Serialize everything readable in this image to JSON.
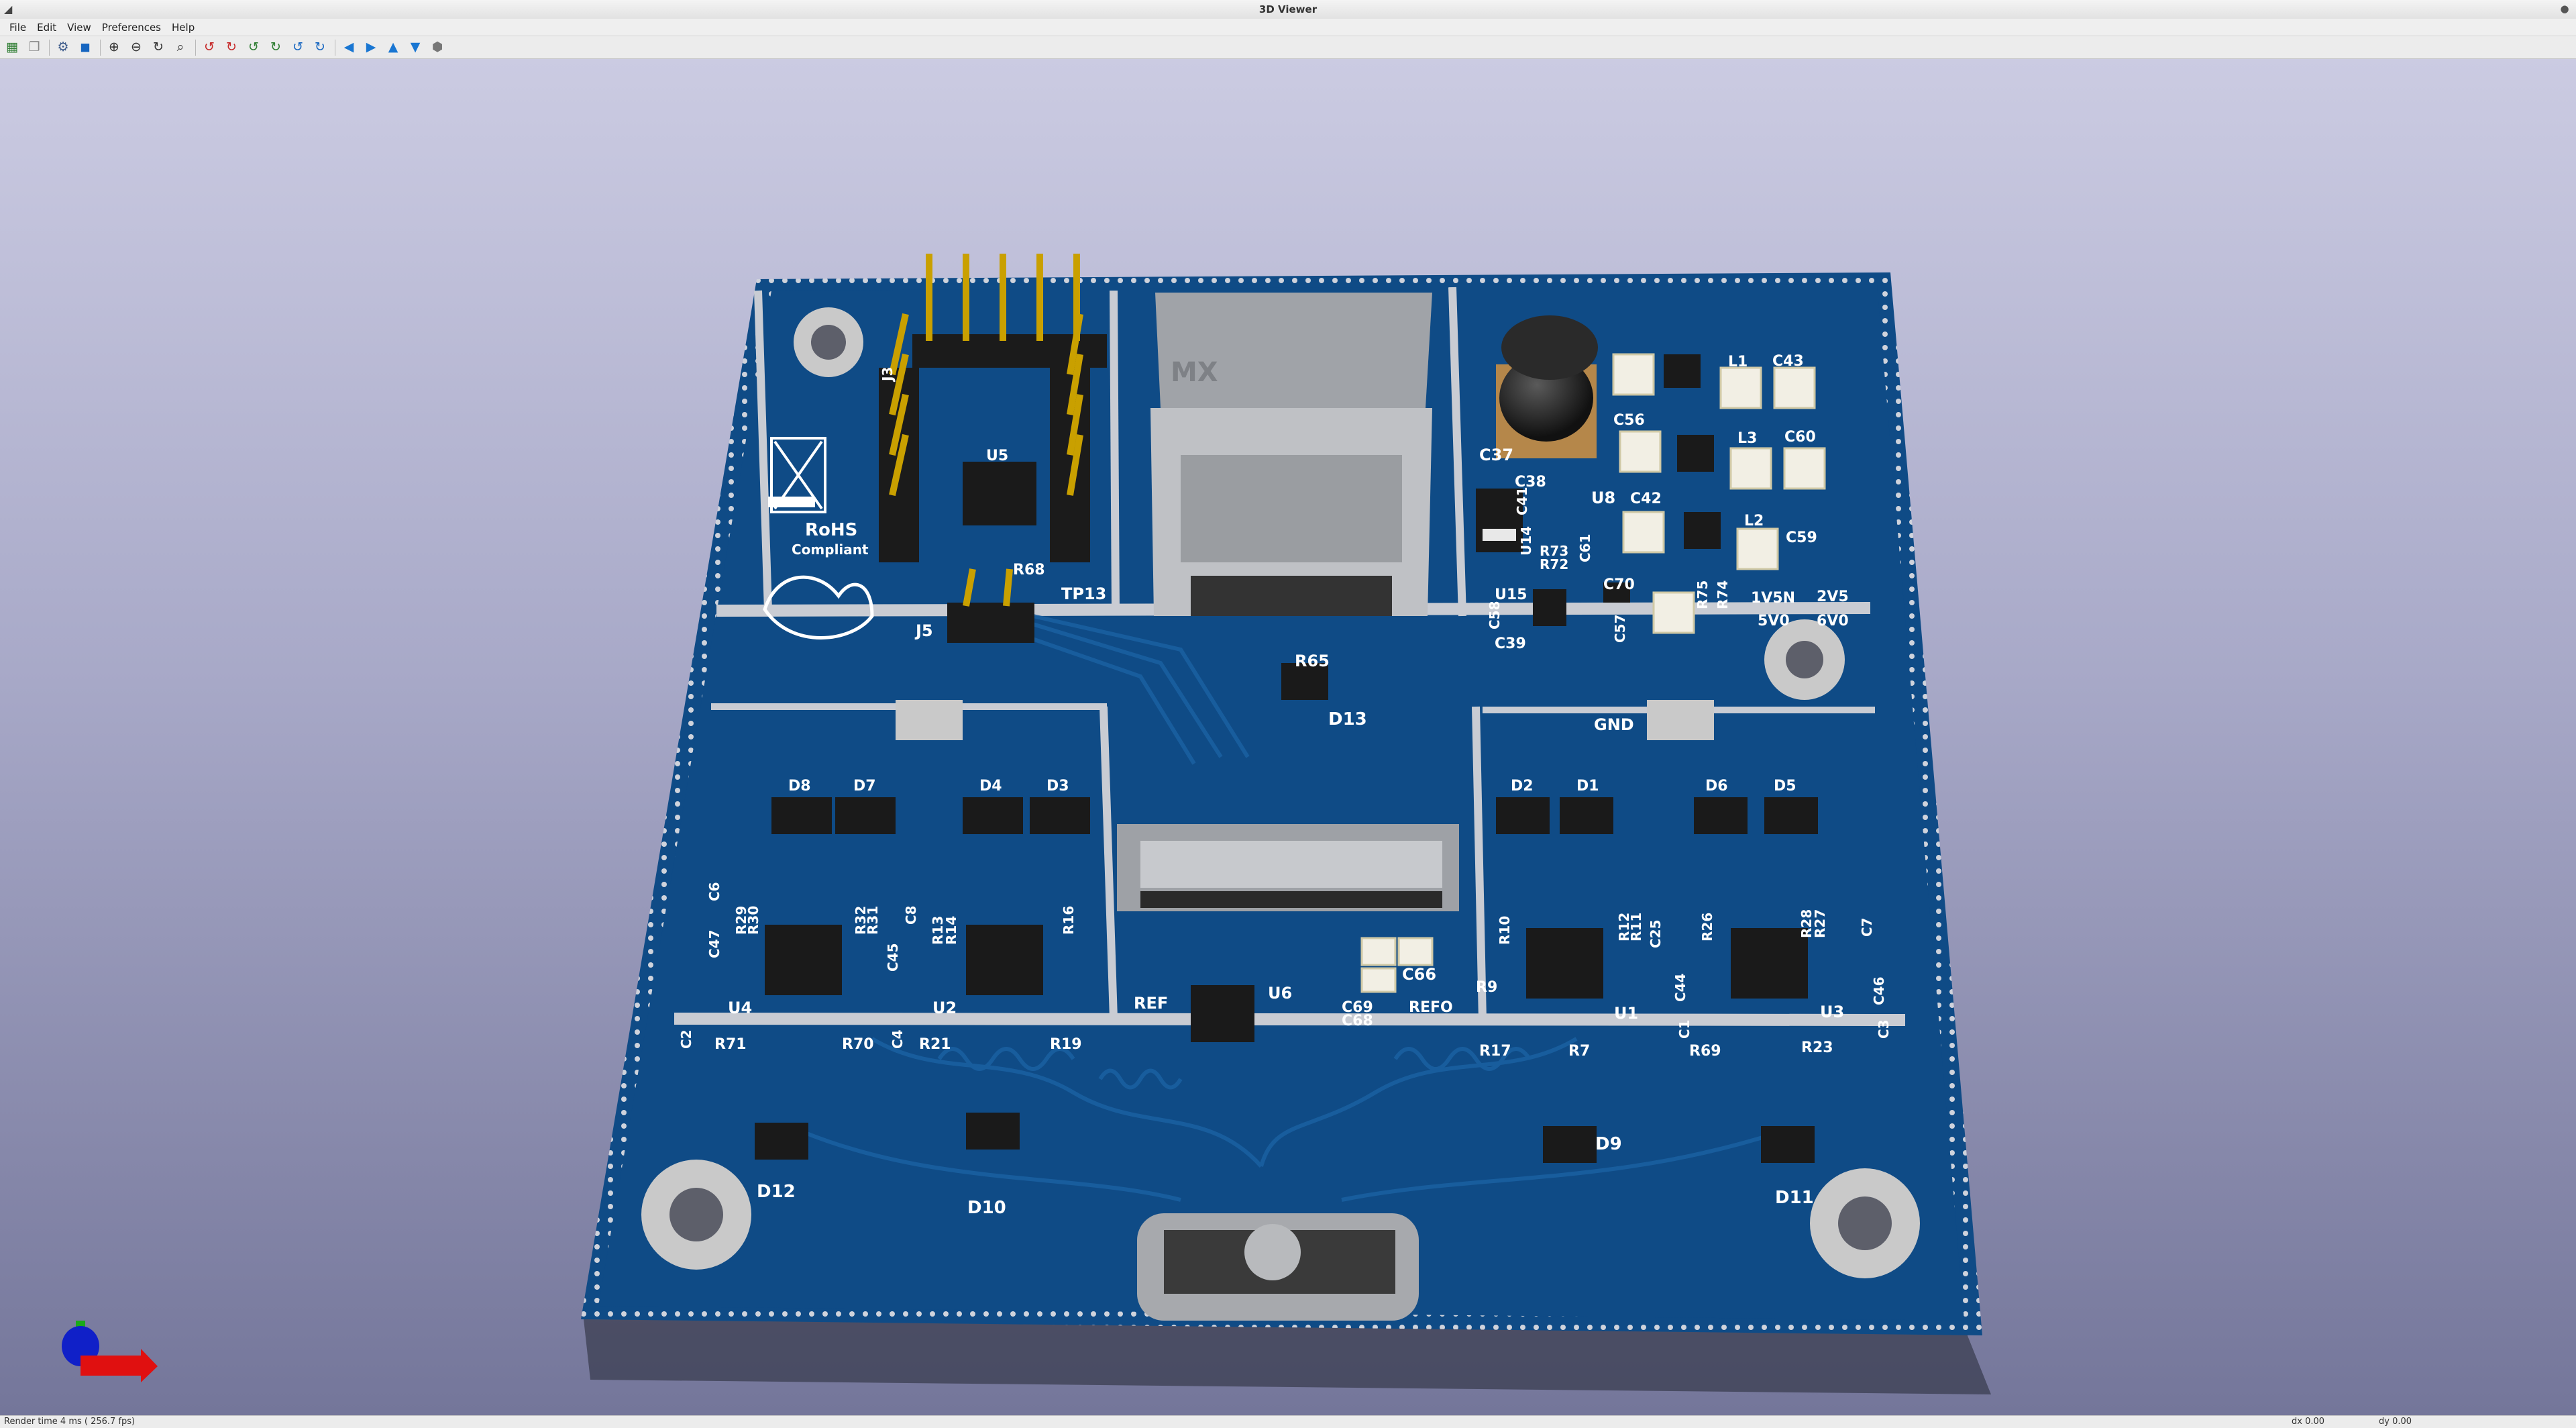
{
  "window": {
    "title": "3D Viewer"
  },
  "menubar": [
    "File",
    "Edit",
    "View",
    "Preferences",
    "Help"
  ],
  "toolbar": [
    {
      "name": "reload-board-icon",
      "glyph": "▦",
      "color": "#2e7d32"
    },
    {
      "name": "copy-image-icon",
      "glyph": "❐",
      "color": "#888888"
    },
    {
      "sep": true
    },
    {
      "name": "render-options-icon",
      "glyph": "⚙",
      "color": "#3c5a8a"
    },
    {
      "name": "raytracing-icon",
      "glyph": "◼",
      "color": "#1565c0"
    },
    {
      "sep": true
    },
    {
      "name": "zoom-in-icon",
      "glyph": "⊕",
      "color": "#333333"
    },
    {
      "name": "zoom-out-icon",
      "glyph": "⊖",
      "color": "#333333"
    },
    {
      "name": "refresh-icon",
      "glyph": "↻",
      "color": "#333333"
    },
    {
      "name": "zoom-fit-icon",
      "glyph": "⌕",
      "color": "#333333"
    },
    {
      "sep": true
    },
    {
      "name": "rotate-x-cw-icon",
      "glyph": "↺",
      "color": "#c62828"
    },
    {
      "name": "rotate-x-ccw-icon",
      "glyph": "↻",
      "color": "#c62828"
    },
    {
      "name": "rotate-y-cw-icon",
      "glyph": "↺",
      "color": "#2e7d32"
    },
    {
      "name": "rotate-y-ccw-icon",
      "glyph": "↻",
      "color": "#2e7d32"
    },
    {
      "name": "rotate-z-cw-icon",
      "glyph": "↺",
      "color": "#1565c0"
    },
    {
      "name": "rotate-z-ccw-icon",
      "glyph": "↻",
      "color": "#1565c0"
    },
    {
      "sep": true
    },
    {
      "name": "move-left-icon",
      "glyph": "◀",
      "color": "#1976d2"
    },
    {
      "name": "move-right-icon",
      "glyph": "▶",
      "color": "#1976d2"
    },
    {
      "name": "move-up-icon",
      "glyph": "▲",
      "color": "#1976d2"
    },
    {
      "name": "move-down-icon",
      "glyph": "▼",
      "color": "#1976d2"
    },
    {
      "name": "orthographic-icon",
      "glyph": "⬢",
      "color": "#777777"
    }
  ],
  "pcb_labels": {
    "J3": "J3",
    "U5": "U5",
    "R68": "R68",
    "J5": "J5",
    "TP13": "TP13",
    "R65": "R65",
    "D13": "D13",
    "C37": "C37",
    "C38": "C38",
    "C41": "C41",
    "U8": "U8",
    "C56": "C56",
    "L1": "L1",
    "C43": "C43",
    "L3": "L3",
    "C60": "C60",
    "C42": "C42",
    "L2": "L2",
    "C59": "C59",
    "U14": "U14",
    "R73": "R73",
    "R72": "R72",
    "C61": "C61",
    "U15": "U15",
    "C58": "C58",
    "C39": "C39",
    "C57": "C57",
    "C70": "C70",
    "R75": "R75",
    "R74": "R74",
    "1V5N": "1V5N",
    "2V5": "2V5",
    "5V0": "5V0",
    "6V0": "6V0",
    "GND": "GND",
    "D8": "D8",
    "D7": "D7",
    "D4": "D4",
    "D3": "D3",
    "D2": "D2",
    "D1": "D1",
    "D6": "D6",
    "D5": "D5",
    "C6": "C6",
    "C47": "C47",
    "R29": "R29",
    "R30": "R30",
    "R32": "R32",
    "R31": "R31",
    "C45": "C45",
    "C8": "C8",
    "R13": "R13",
    "R14": "R14",
    "R16": "R16",
    "U4": "U4",
    "U2": "U2",
    "C2": "C2",
    "C4": "C4",
    "R71": "R71",
    "R70": "R70",
    "R21": "R21",
    "R19": "R19",
    "REF": "REF",
    "U6": "U6",
    "C66": "C66",
    "C69": "C69",
    "C68": "C68",
    "REFO": "REFO",
    "R10": "R10",
    "R9": "R9",
    "R12": "R12",
    "R11": "R11",
    "C25": "C25",
    "R26": "R26",
    "R28": "R28",
    "R27": "R27",
    "C7": "C7",
    "C44": "C44",
    "U1": "U1",
    "U3": "U3",
    "C46": "C46",
    "C1": "C1",
    "C3": "C3",
    "R17": "R17",
    "R7": "R7",
    "R69": "R69",
    "R23": "R23",
    "D12": "D12",
    "D10": "D10",
    "D9": "D9",
    "D11": "D11",
    "rohs": "RoHS",
    "compliant": "Compliant",
    "conn_mark": "MX"
  },
  "status": {
    "render_time": "Render time 4 ms ( 256.7 fps)",
    "dx": "dx 0.00",
    "dy": "dy 0.00"
  },
  "colors": {
    "board": "#0f4b86",
    "silk": "#ffffff",
    "pad": "#d9d9d9",
    "bg_top": "#cbcbe2",
    "bg_bottom": "#74769a"
  }
}
